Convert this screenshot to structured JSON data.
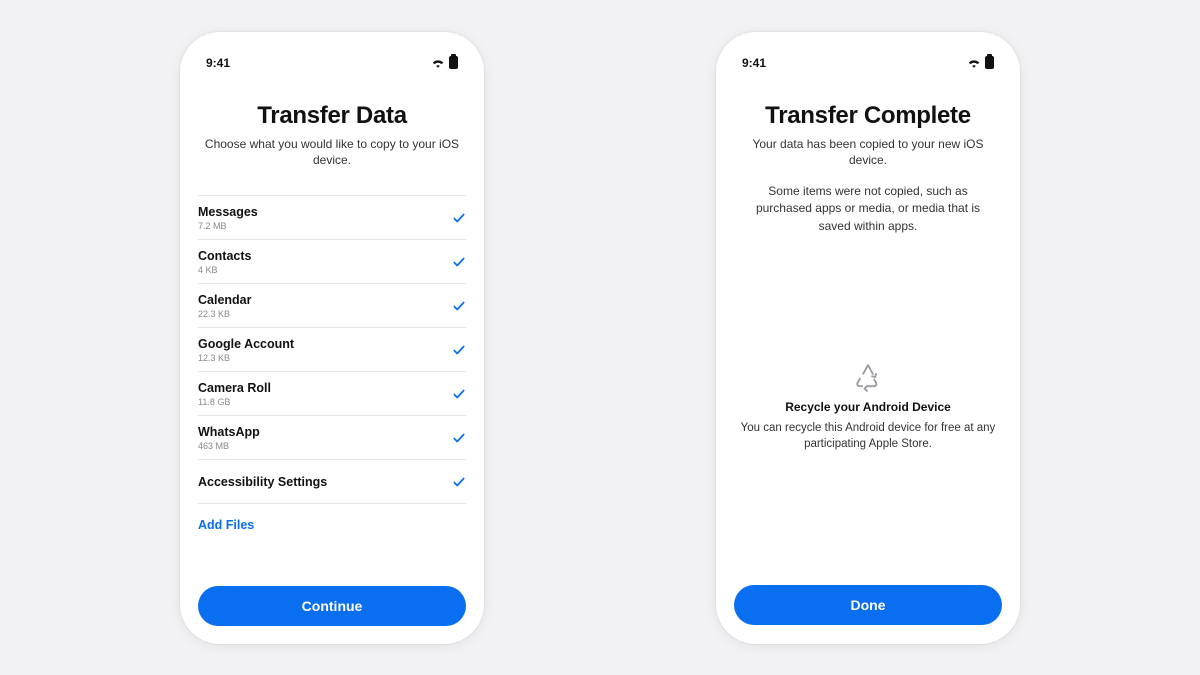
{
  "status": {
    "time": "9:41"
  },
  "left": {
    "title": "Transfer Data",
    "subtitle": "Choose what you would like to copy to your iOS device.",
    "items": [
      {
        "name": "Messages",
        "size": "7.2 MB"
      },
      {
        "name": "Contacts",
        "size": "4 KB"
      },
      {
        "name": "Calendar",
        "size": "22.3 KB"
      },
      {
        "name": "Google Account",
        "size": "12.3 KB"
      },
      {
        "name": "Camera Roll",
        "size": "11.8 GB"
      },
      {
        "name": "WhatsApp",
        "size": "463 MB"
      },
      {
        "name": "Accessibility Settings",
        "size": ""
      }
    ],
    "add_files": "Add Files",
    "continue_label": "Continue"
  },
  "right": {
    "title": "Transfer Complete",
    "subtitle": "Your data has been copied to your new iOS device.",
    "note": "Some items were not copied, such as purchased apps or media, or media that is saved within apps.",
    "recycle_title": "Recycle your Android Device",
    "recycle_text": "You can recycle this Android device for free at any participating Apple Store.",
    "done_label": "Done"
  }
}
